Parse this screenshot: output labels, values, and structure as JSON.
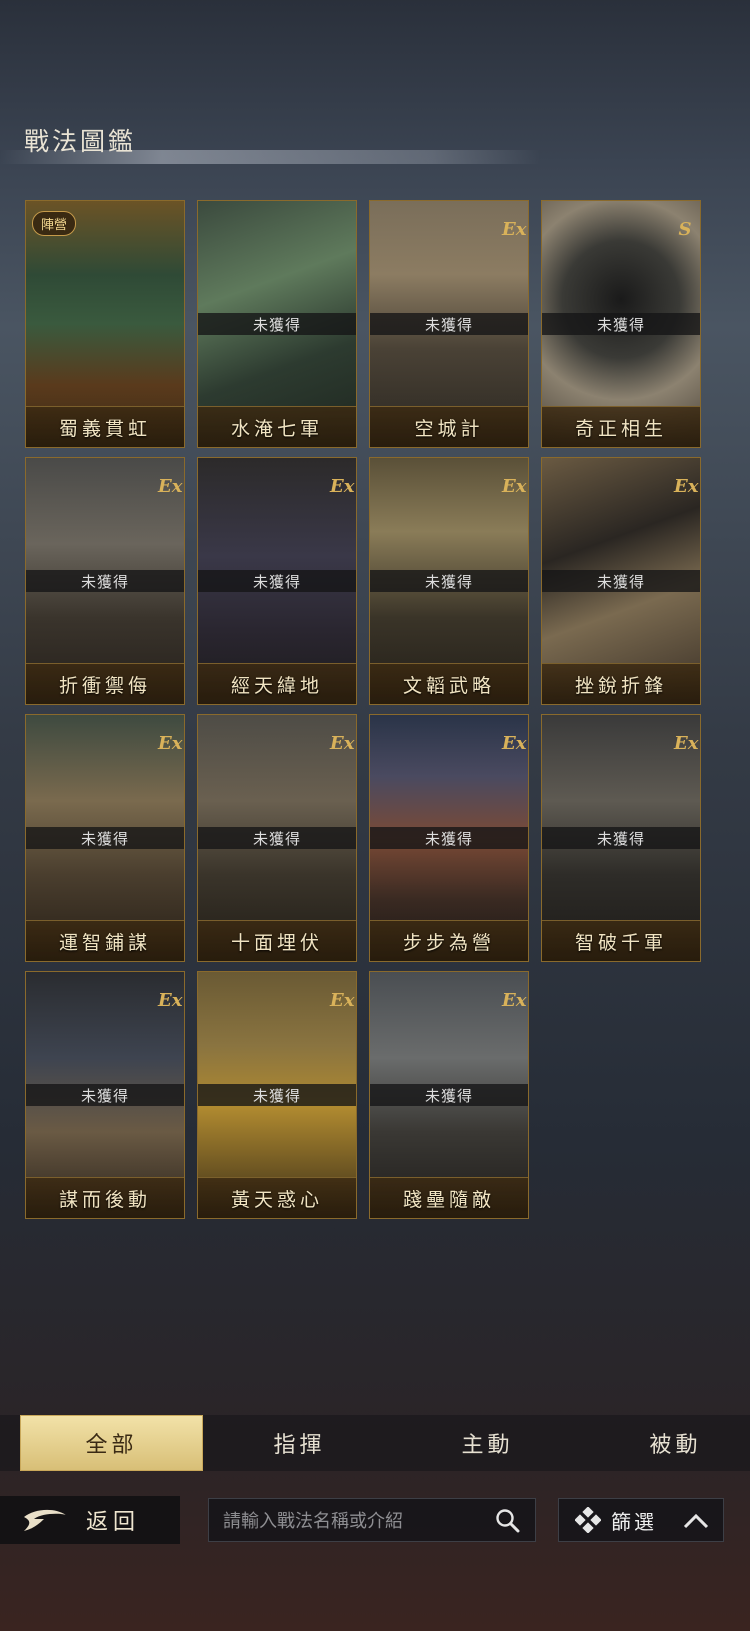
{
  "title": "戰法圖鑑",
  "locked_text": "未獲得",
  "cards": [
    {
      "name": "蜀義貫虹",
      "locked": false,
      "badge": "陣營",
      "ex": false,
      "art": "shu"
    },
    {
      "name": "水淹七軍",
      "locked": true,
      "ex": false,
      "art": "water"
    },
    {
      "name": "空城計",
      "locked": true,
      "ex": true,
      "art": "city"
    },
    {
      "name": "奇正相生",
      "locked": true,
      "ex": false,
      "badge_s": true,
      "art": "yinyang"
    },
    {
      "name": "折衝禦侮",
      "locked": true,
      "ex": true,
      "art": "warriors"
    },
    {
      "name": "經天緯地",
      "locked": true,
      "ex": true,
      "art": "scholar"
    },
    {
      "name": "文韜武略",
      "locked": true,
      "ex": true,
      "art": "general"
    },
    {
      "name": "挫銳折鋒",
      "locked": true,
      "ex": true,
      "art": "arrows"
    },
    {
      "name": "運智鋪謀",
      "locked": true,
      "ex": true,
      "art": "map"
    },
    {
      "name": "十面埋伏",
      "locked": true,
      "ex": true,
      "art": "ambush"
    },
    {
      "name": "步步為營",
      "locked": true,
      "ex": true,
      "art": "camp"
    },
    {
      "name": "智破千軍",
      "locked": true,
      "ex": true,
      "art": "strategist"
    },
    {
      "name": "謀而後動",
      "locked": true,
      "ex": true,
      "art": "council"
    },
    {
      "name": "黃天惑心",
      "locked": true,
      "ex": true,
      "art": "yellow"
    },
    {
      "name": "踐壘隨敵",
      "locked": true,
      "ex": true,
      "art": "rider"
    }
  ],
  "ex_label": "Ex",
  "tabs": [
    {
      "label": "全部",
      "active": true
    },
    {
      "label": "指揮",
      "active": false
    },
    {
      "label": "主動",
      "active": false
    },
    {
      "label": "被動",
      "active": false
    }
  ],
  "back_label": "返回",
  "search_placeholder": "請輸入戰法名稱或介紹",
  "filter_label": "篩選",
  "colors": {
    "gold_border": "#8a6a2c",
    "active_tab": "#e6cf8a"
  }
}
